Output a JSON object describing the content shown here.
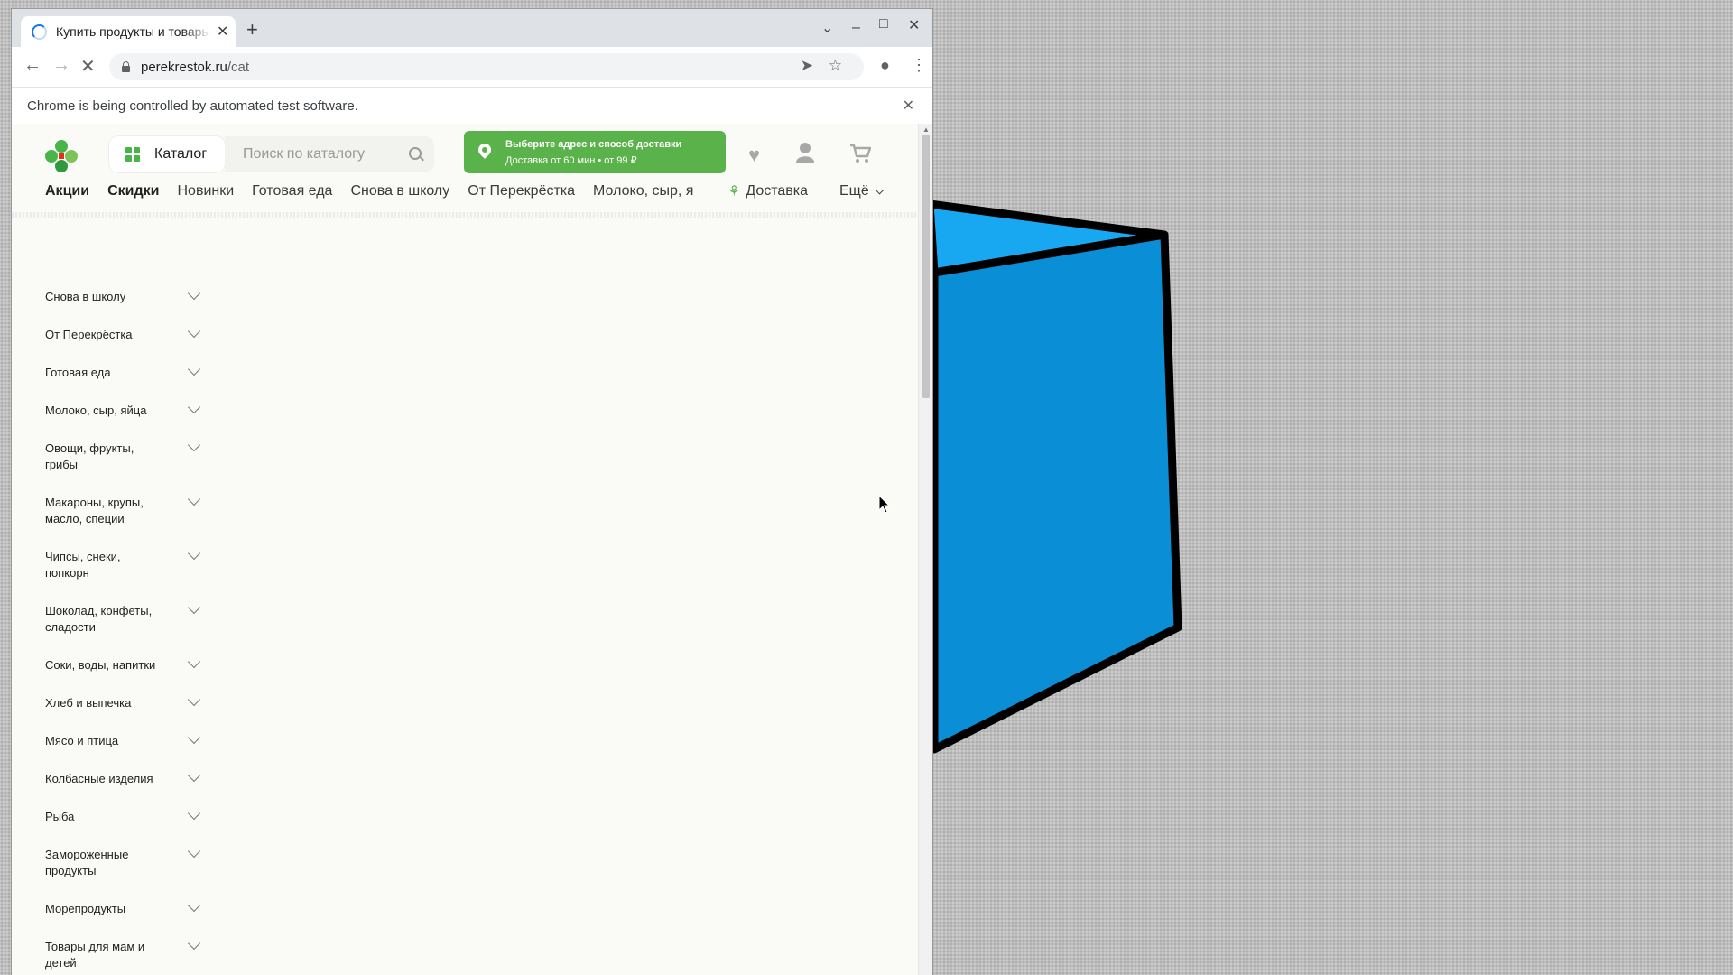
{
  "browser": {
    "tab_title": "Купить продукты и товары",
    "new_tab": "+",
    "url_host": "perekrestok.ru",
    "url_path": "/cat",
    "infobar_text": "Chrome is being controlled by automated test software."
  },
  "site": {
    "catalog_label": "Каталог",
    "search_placeholder": "Поиск по каталогу",
    "delivery_line1": "Выберите адрес и способ доставки",
    "delivery_line2": "Доставка от 60 мин • от 99 ₽",
    "nav_bold": [
      "Акции",
      "Скидки"
    ],
    "nav_items": [
      "Новинки",
      "Готовая еда",
      "Снова в школу",
      "От Перекрёстка",
      "Молоко, сыр, я"
    ],
    "nav_delivery": "Доставка",
    "nav_more": "Ещё"
  },
  "categories": [
    "Снова в школу",
    "От Перекрёстка",
    "Готовая еда",
    "Молоко, сыр, яйца",
    "Овощи, фрукты, грибы",
    "Макароны, крупы, масло, специи",
    "Чипсы, снеки, попкорн",
    "Шоколад, конфеты, сладости",
    "Соки, воды, напитки",
    "Хлеб и выпечка",
    "Мясо и птица",
    "Колбасные изделия",
    "Рыба",
    "Замороженные продукты",
    "Морепродукты",
    "Товары для мам и детей"
  ],
  "colors": {
    "brand_green": "#5ab24a",
    "box_blue": "#0a8fd6",
    "box_top_blue": "#18a8f2"
  }
}
